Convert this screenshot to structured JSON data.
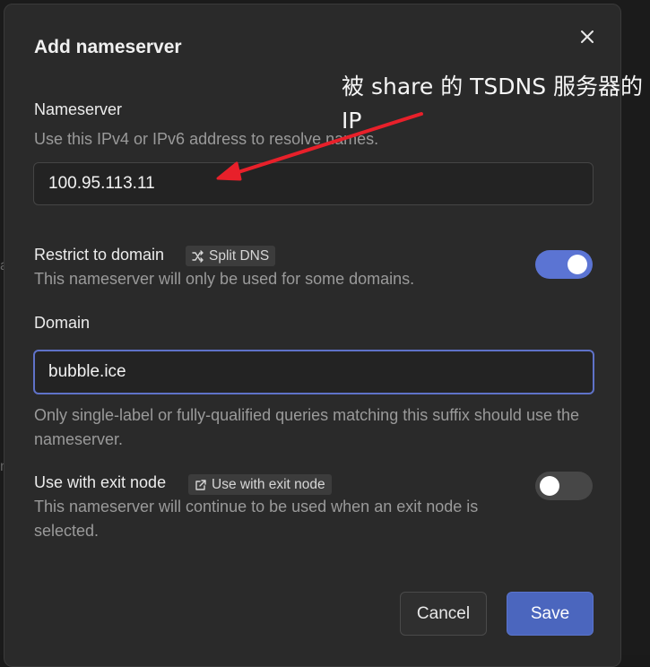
{
  "dialog": {
    "title": "Add nameserver",
    "close_icon": "close-icon"
  },
  "nameserver": {
    "label": "Nameserver",
    "description": "Use this IPv4 or IPv6 address to resolve names.",
    "value": "100.95.113.11"
  },
  "restrict": {
    "label": "Restrict to domain",
    "badge_icon": "shuffle-icon",
    "badge": "Split DNS",
    "description": "This nameserver will only be used for some domains.",
    "enabled": true
  },
  "domain": {
    "label": "Domain",
    "value": "bubble.ice",
    "help": "Only single-label or fully-qualified queries matching this suffix should use the nameserver."
  },
  "exit_node": {
    "label": "Use with exit node",
    "badge_icon": "external-link-icon",
    "badge": "Use with exit node",
    "description": "This nameserver will continue to be used when an exit node is selected.",
    "enabled": false
  },
  "buttons": {
    "cancel": "Cancel",
    "save": "Save"
  },
  "annotation": {
    "text": "被 share 的 TSDNS 服务器的 IP",
    "color": "#e8202a"
  },
  "colors": {
    "accent": "#5b74d3",
    "save_button": "#4b66be",
    "focus_border": "#5f72c8"
  }
}
